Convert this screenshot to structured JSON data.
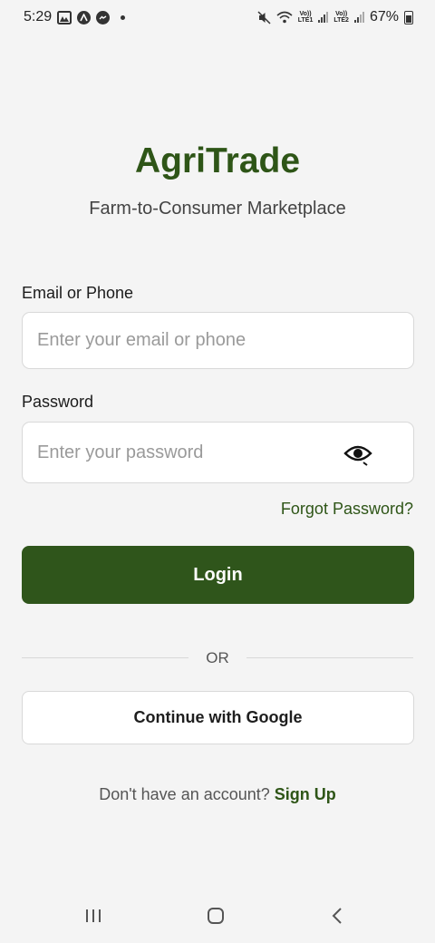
{
  "status_bar": {
    "time": "5:29",
    "battery": "67%",
    "sim1": {
      "top": "Vo))",
      "bottom": "LTE1"
    },
    "sim2": {
      "top": "Vo))",
      "bottom": "LTE2"
    },
    "icons": [
      "gallery-icon",
      "app-icon",
      "messenger-icon",
      "notification-dot",
      "mute-icon",
      "wifi-icon",
      "signal-icon",
      "battery-icon"
    ]
  },
  "app": {
    "title": "AgriTrade",
    "tagline": "Farm-to-Consumer Marketplace"
  },
  "form": {
    "email_label": "Email or Phone",
    "email_placeholder": "Enter your email or phone",
    "password_label": "Password",
    "password_placeholder": "Enter your password",
    "forgot_label": "Forgot Password?",
    "login_label": "Login",
    "or_label": "OR",
    "google_label": "Continue with Google",
    "signup_prompt": "Don't have an account?",
    "signup_label": "Sign Up"
  },
  "colors": {
    "brand": "#2e5517",
    "button": "#2f551b",
    "background": "#f4f4f4"
  },
  "nav_bar": {
    "icons": [
      "recent-apps-icon",
      "home-icon",
      "back-icon"
    ]
  }
}
